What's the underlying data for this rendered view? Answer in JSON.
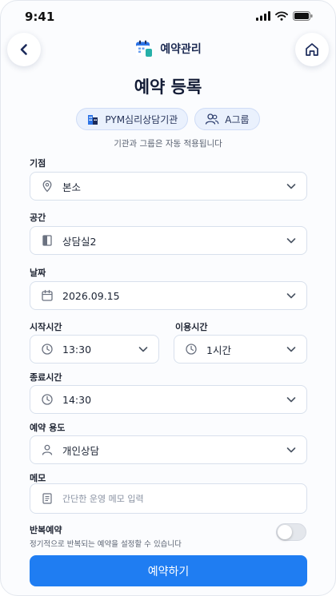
{
  "status_bar": {
    "time": "9:41"
  },
  "header": {
    "brand_name": "예약관리",
    "title": "예약 등록",
    "org_chip": "PYM심리상담기관",
    "group_chip": "A그룹",
    "note": "기관과 그룹은 자동 적용됩니다"
  },
  "form": {
    "branch": {
      "label": "기점",
      "value": "본소",
      "icon": "location-pin-icon"
    },
    "room": {
      "label": "공간",
      "value": "상담실2",
      "icon": "door-icon"
    },
    "date": {
      "label": "날짜",
      "value": "2026.09.15",
      "icon": "calendar-icon"
    },
    "start_time": {
      "label": "시작시간",
      "value": "13:30",
      "icon": "clock-icon"
    },
    "duration": {
      "label": "이용시간",
      "value": "1시간",
      "icon": "clock-icon"
    },
    "end_time": {
      "label": "종료시간",
      "value": "14:30",
      "icon": "clock-icon"
    },
    "purpose": {
      "label": "예약 용도",
      "value": "개인상담",
      "icon": "person-icon"
    },
    "memo": {
      "label": "메모",
      "placeholder": "간단한 운영 메모 입력",
      "icon": "memo-icon"
    },
    "repeat": {
      "label": "반복예약",
      "description": "정기적으로 반복되는 예약을 설정할 수 있습니다",
      "enabled": false
    }
  },
  "submit_label": "예약하기",
  "colors": {
    "accent": "#1f7df2",
    "chip_background": "#eaf1fd",
    "title_text": "#131c36"
  }
}
